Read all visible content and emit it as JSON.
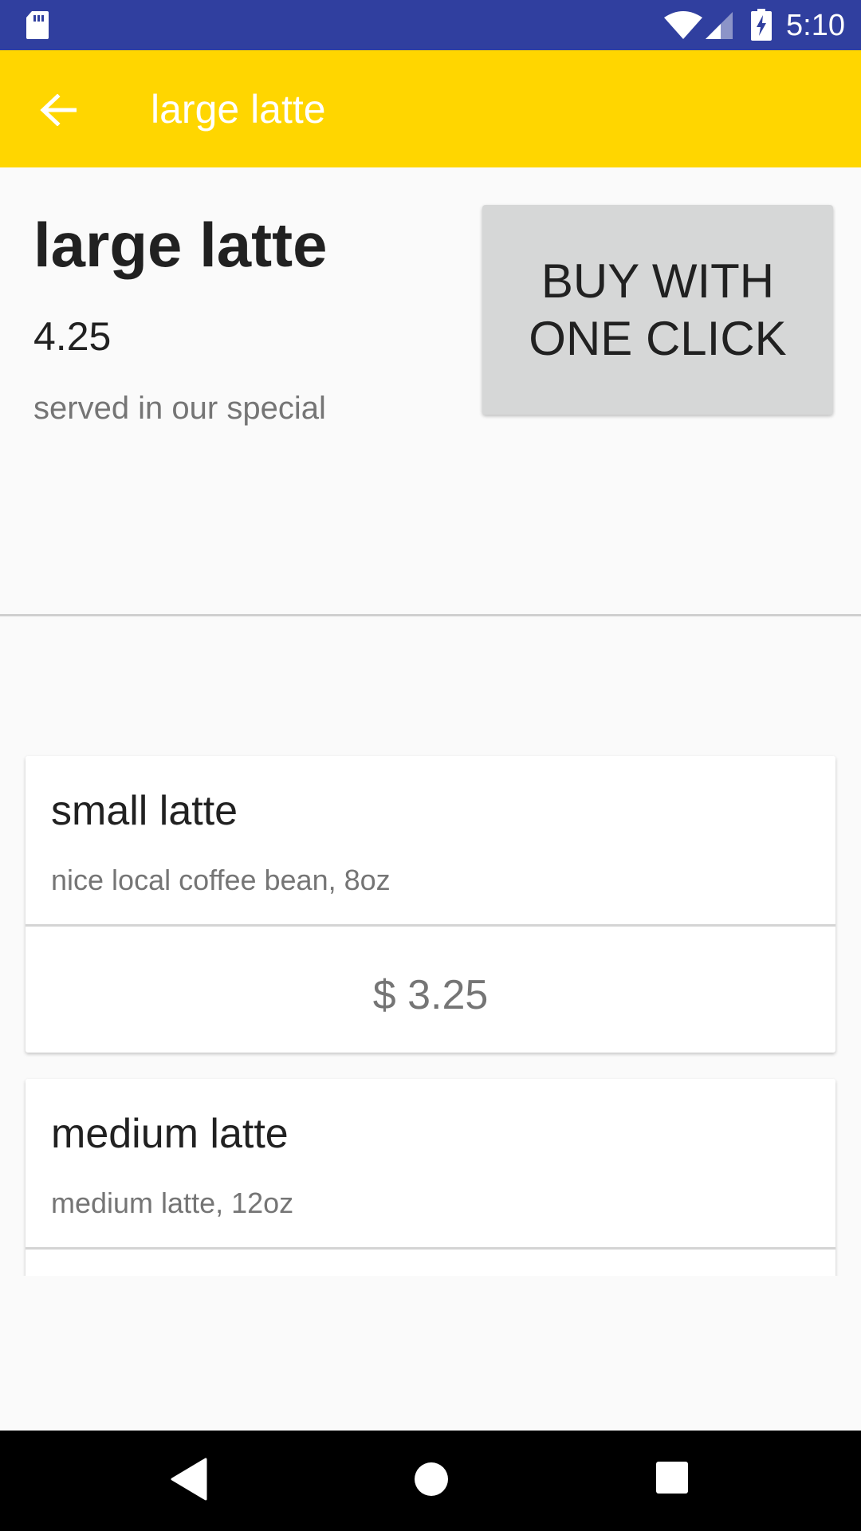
{
  "status_bar": {
    "time": "5:10",
    "icons": [
      "sd-card-icon",
      "wifi-icon",
      "signal-icon",
      "battery-charging-icon"
    ]
  },
  "app_bar": {
    "back_icon": "arrow-back-icon",
    "title": "large latte"
  },
  "product": {
    "name": "large latte",
    "price": "4.25",
    "description": "served in our special",
    "buy_label": "BUY WITH ONE CLICK"
  },
  "items": [
    {
      "name": "small latte",
      "description": "nice local coffee bean, 8oz",
      "price": "$ 3.25"
    },
    {
      "name": "medium latte",
      "description": "medium latte, 12oz",
      "price": ""
    }
  ],
  "nav_bar": {
    "icons": [
      "nav-back-icon",
      "nav-home-icon",
      "nav-recents-icon"
    ]
  },
  "colors": {
    "status_bar": "#303f9f",
    "app_bar": "#ffd600",
    "buy_button": "#d6d7d7",
    "background": "#fafafa"
  }
}
